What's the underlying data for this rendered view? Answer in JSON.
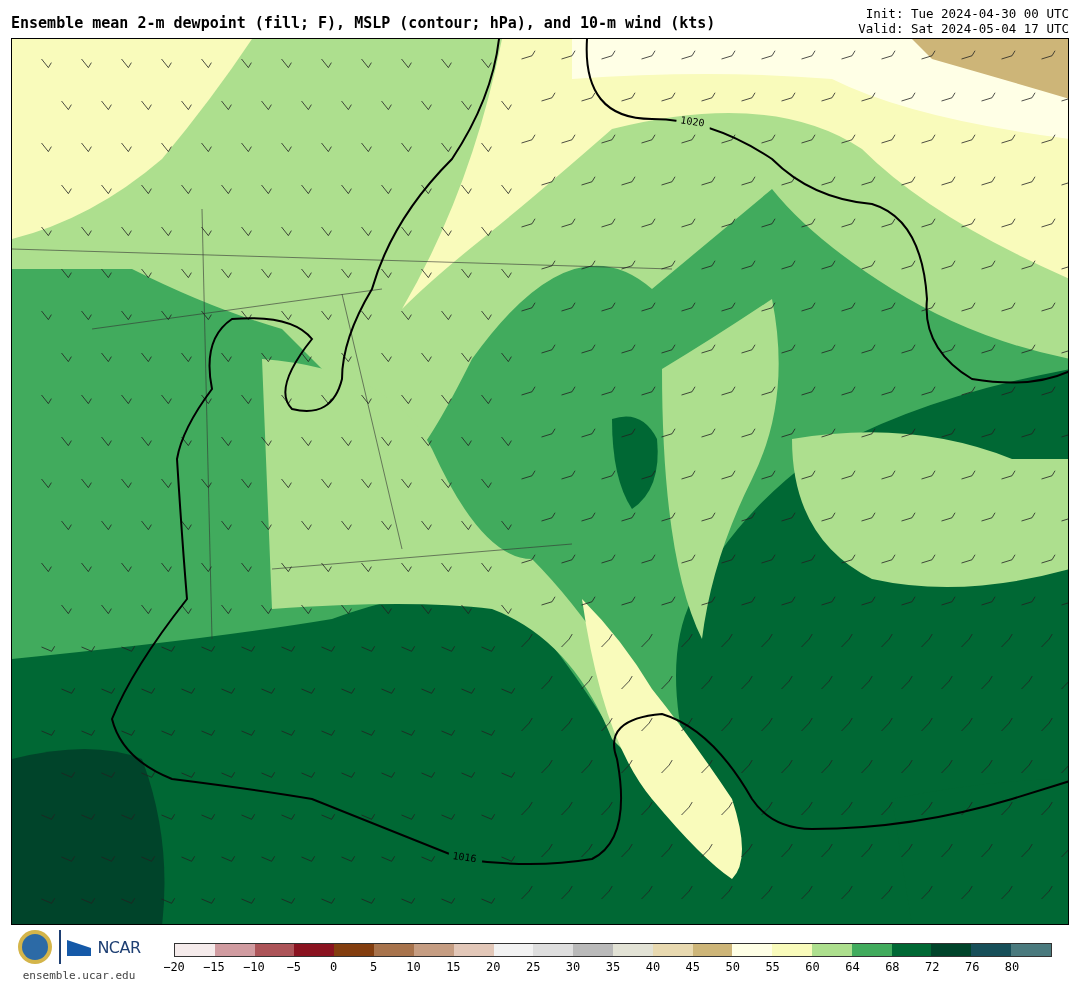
{
  "title": "Ensemble mean 2-m dewpoint (fill; F), MSLP (contour; hPa), and 10-m wind (kts)",
  "init": "Init: Tue 2024-04-30 00 UTC",
  "valid": "Valid: Sat 2024-05-04 17 UTC",
  "map": {
    "kind": "map",
    "isobar_labels": [
      "1020",
      "1016"
    ]
  },
  "footer": {
    "logo_text": "NCAR",
    "url": "ensemble.ucar.edu"
  },
  "colorbar": {
    "segments": [
      {
        "color": "#f5ebeb"
      },
      {
        "color": "#d09ba0"
      },
      {
        "color": "#ac5458"
      },
      {
        "color": "#8a1320"
      },
      {
        "color": "#833e0f"
      },
      {
        "color": "#a7734c"
      },
      {
        "color": "#c59d82"
      },
      {
        "color": "#e2c7b8"
      },
      {
        "color": "#f2f2f2"
      },
      {
        "color": "#dedede"
      },
      {
        "color": "#b9b9b9"
      },
      {
        "color": "#e2e2d5"
      },
      {
        "color": "#e8d9b0"
      },
      {
        "color": "#cdb578"
      },
      {
        "color": "#ffffe6"
      },
      {
        "color": "#f9fbbb"
      },
      {
        "color": "#addf8e"
      },
      {
        "color": "#41ab5d"
      },
      {
        "color": "#006834"
      },
      {
        "color": "#00442a"
      },
      {
        "color": "#174f59"
      },
      {
        "color": "#4a7a7e"
      }
    ],
    "ticks": [
      "−20",
      "−15",
      "−10",
      "−5",
      "0",
      "5",
      "10",
      "15",
      "20",
      "25",
      "30",
      "35",
      "40",
      "45",
      "50",
      "55",
      "60",
      "64",
      "68",
      "72",
      "76",
      "80"
    ]
  }
}
